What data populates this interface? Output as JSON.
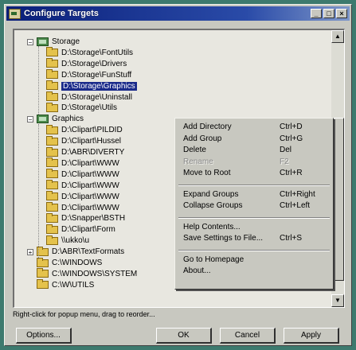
{
  "window": {
    "title": "Configure Targets",
    "controls": [
      "_",
      "□",
      "×"
    ]
  },
  "tree": {
    "expand_minus": "−",
    "expand_plus": "+",
    "items": [
      {
        "label": "Storage",
        "kind": "drive",
        "expander": "minus"
      },
      {
        "label": "D:\\Storage\\FontUtils",
        "kind": "folder"
      },
      {
        "label": "D:\\Storage\\Drivers",
        "kind": "folder"
      },
      {
        "label": "D:\\Storage\\FunStuff",
        "kind": "folder"
      },
      {
        "label": "D:\\Storage\\Graphics",
        "kind": "folder",
        "selected": true
      },
      {
        "label": "D:\\Storage\\Uninstall",
        "kind": "folder"
      },
      {
        "label": "D:\\Storage\\Utils",
        "kind": "folder"
      },
      {
        "label": "Graphics",
        "kind": "drive",
        "expander": "minus"
      },
      {
        "label": "D:\\Clipart\\PILDID",
        "kind": "folder"
      },
      {
        "label": "D:\\Clipart\\Hussel",
        "kind": "folder"
      },
      {
        "label": "D:\\ABR\\DIVERTY",
        "kind": "folder"
      },
      {
        "label": "D:\\Clipart\\WWW",
        "kind": "folder"
      },
      {
        "label": "D:\\Clipart\\WWW",
        "kind": "folder"
      },
      {
        "label": "D:\\Clipart\\WWW",
        "kind": "folder"
      },
      {
        "label": "D:\\Clipart\\WWW",
        "kind": "folder"
      },
      {
        "label": "D:\\Clipart\\WWW",
        "kind": "folder"
      },
      {
        "label": "D:\\Snapper\\BSTH",
        "kind": "folder"
      },
      {
        "label": "D:\\Clipart\\Form",
        "kind": "folder"
      },
      {
        "label": "\\\\ukko\\u",
        "kind": "folder"
      },
      {
        "label": "D:\\ABR\\TextFormats",
        "kind": "folder",
        "expander": "plus"
      },
      {
        "label": "C:\\WINDOWS",
        "kind": "folder"
      },
      {
        "label": "C:\\WINDOWS\\SYSTEM",
        "kind": "folder"
      },
      {
        "label": "C:\\W\\UTILS",
        "kind": "folder"
      }
    ]
  },
  "scrollbar": {
    "up": "▲",
    "down": "▼"
  },
  "context_menu": {
    "items": [
      {
        "label": "Add Directory",
        "shortcut": "Ctrl+D"
      },
      {
        "label": "Add Group",
        "shortcut": "Ctrl+G"
      },
      {
        "label": "Delete",
        "shortcut": "Del"
      },
      {
        "label": "Rename",
        "shortcut": "F2",
        "disabled": true
      },
      {
        "label": "Move to Root",
        "shortcut": "Ctrl+R"
      },
      {
        "separator": true
      },
      {
        "label": "Expand Groups",
        "shortcut": "Ctrl+Right"
      },
      {
        "label": "Collapse Groups",
        "shortcut": "Ctrl+Left"
      },
      {
        "separator": true
      },
      {
        "label": "Help Contents...",
        "shortcut": ""
      },
      {
        "label": "Save Settings to File...",
        "shortcut": "Ctrl+S"
      },
      {
        "separator": true
      },
      {
        "label": "Go to Homepage",
        "shortcut": ""
      },
      {
        "label": "About...",
        "shortcut": ""
      }
    ]
  },
  "status_text": "Right-click for popup menu, drag to reorder...",
  "buttons": {
    "options": "Options...",
    "ok": "OK",
    "cancel": "Cancel",
    "apply": "Apply"
  }
}
